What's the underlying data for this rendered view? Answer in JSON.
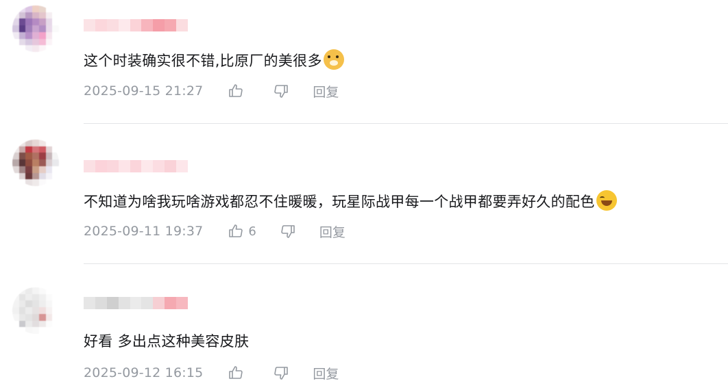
{
  "comments": [
    {
      "text": "这个时装确实很不错,比原厂的美很多",
      "emoji": "doge-emoji",
      "time": "2025-09-15 21:27",
      "likes": "",
      "reply_label": "回复"
    },
    {
      "text": "不知道为啥我玩啥游戏都忍不住暖暖，玩星际战甲每一个战甲都要弄好久的配色",
      "emoji": "laughing-tears-emoji",
      "time": "2025-09-11 19:37",
      "likes": "6",
      "reply_label": "回复"
    },
    {
      "text": "好看 多出点这种美容皮肤",
      "emoji": "",
      "time": "2025-09-12 16:15",
      "likes": "",
      "reply_label": "回复"
    }
  ],
  "colors": {
    "text": "#18191c",
    "meta": "#9499a0",
    "divider": "#e3e5e7",
    "name_blur_pink": "#f4a7b0"
  },
  "icons": [
    "like-icon",
    "dislike-icon"
  ]
}
